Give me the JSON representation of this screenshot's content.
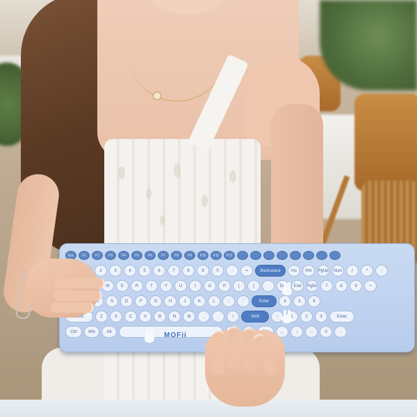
{
  "scene": {
    "subject": "woman holding keyboard",
    "keyboard_brand": "MOFii",
    "colors": {
      "keyboard_body": "#c2d5f0",
      "keycap": "#eef3fb",
      "accent_key": "#4f7cc2",
      "dress": "#f4f2ee",
      "hair": "#5b3a24"
    }
  },
  "keyboard": {
    "brand_label": "MOFii",
    "row_numbers": [
      "Esc",
      "F1",
      "F2",
      "F3",
      "F4",
      "F5",
      "F6",
      "F7",
      "F8",
      "F9",
      "F10",
      "F11",
      "F12",
      "",
      "",
      "",
      "",
      "",
      "",
      "",
      ""
    ],
    "row_digits": [
      "~",
      "1",
      "2",
      "3",
      "4",
      "5",
      "6",
      "7",
      "8",
      "9",
      "0",
      "-",
      "=",
      "Backspace",
      "Ins",
      "Hm",
      "PgUp",
      "Num",
      "/",
      "*",
      "-"
    ],
    "row_q": [
      "Tab",
      "Q",
      "W",
      "E",
      "R",
      "T",
      "Y",
      "U",
      "I",
      "O",
      "P",
      "[",
      "]",
      "",
      "Del",
      "End",
      "PgDn",
      "7",
      "8",
      "9",
      "+"
    ],
    "row_a": [
      "Caps",
      "A",
      "S",
      "D",
      "F",
      "G",
      "H",
      "J",
      "K",
      "L",
      ";",
      "'",
      "Enter",
      "4",
      "5",
      "6"
    ],
    "row_z": [
      "Shift",
      "Z",
      "X",
      "C",
      "V",
      "B",
      "N",
      "M",
      ",",
      ".",
      "/",
      "Shift",
      "↑",
      "1",
      "2",
      "3",
      "Enter"
    ],
    "row_space": [
      "Ctrl",
      "Win",
      "Alt",
      "",
      "Alt",
      "Fn",
      "Ctrl",
      "←",
      "↓",
      "→",
      "0",
      "."
    ]
  }
}
